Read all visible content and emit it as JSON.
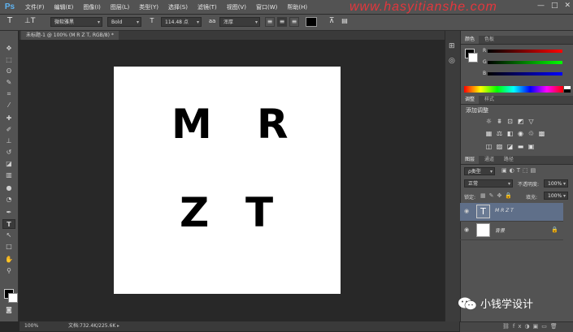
{
  "app": {
    "logo": "Ps",
    "watermark": "www.hasyitianshe.com"
  },
  "menu": [
    "文件(F)",
    "编辑(E)",
    "图像(I)",
    "图层(L)",
    "类型(Y)",
    "选择(S)",
    "滤镜(T)",
    "视图(V)",
    "窗口(W)",
    "帮助(H)"
  ],
  "window_controls": [
    "—",
    "□",
    "✕"
  ],
  "options": {
    "font_family": "微软雅黑",
    "font_style": "Bold",
    "font_size": "114.48 点",
    "anti_alias": "浑厚",
    "text_color": "#000000"
  },
  "document": {
    "tab_title": "未标题-1 @ 100% (M R Z T, RGB/8) *",
    "letters": [
      "M",
      "R",
      "Z",
      "T"
    ]
  },
  "status": {
    "zoom": "100%",
    "doc_size": "文档:732.4K/225.6K"
  },
  "color_panel": {
    "tabs": [
      "颜色",
      "色板"
    ],
    "channels": [
      {
        "label": "R",
        "value": "0"
      },
      {
        "label": "G",
        "value": "0"
      },
      {
        "label": "B",
        "value": "0"
      }
    ]
  },
  "adjust_panel": {
    "tabs": [
      "调整",
      "样式"
    ],
    "title": "添加调整"
  },
  "layers_panel": {
    "tabs": [
      "图层",
      "通道",
      "路径"
    ],
    "filter": "ρ类型",
    "blend": "正常",
    "opacity_label": "不透明度:",
    "opacity": "100%",
    "lock_label": "锁定:",
    "fill_label": "填充:",
    "fill": "100%",
    "layers": [
      {
        "name": "M R Z T",
        "type": "text",
        "selected": true
      },
      {
        "name": "背景",
        "type": "background",
        "selected": false
      }
    ]
  },
  "brand": {
    "text": "小钱学设计"
  }
}
